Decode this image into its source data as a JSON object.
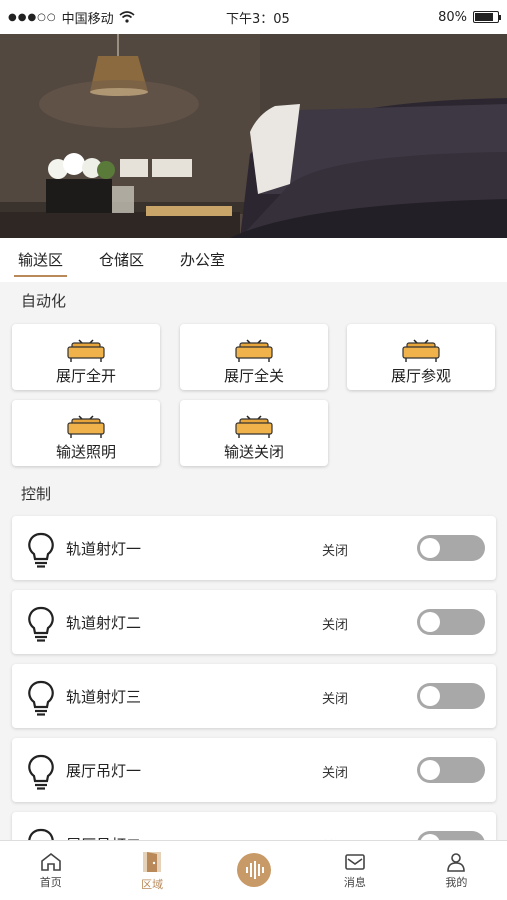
{
  "status_bar": {
    "carrier": "中国移动",
    "time": "下午3：05",
    "battery": "80%",
    "battery_level": 0.8
  },
  "tabs": [
    {
      "label": "输送区",
      "active": true
    },
    {
      "label": "仓储区"
    },
    {
      "label": "办公室"
    }
  ],
  "sections": {
    "automation": "自动化",
    "control": "控制"
  },
  "scenes": [
    {
      "label": "展厅全开"
    },
    {
      "label": "展厅全关"
    },
    {
      "label": "展厅参观"
    },
    {
      "label": "输送照明"
    },
    {
      "label": "输送关闭"
    }
  ],
  "controls": [
    {
      "name": "轨道射灯一",
      "status": "关闭",
      "on": false
    },
    {
      "name": "轨道射灯二",
      "status": "关闭",
      "on": false
    },
    {
      "name": "轨道射灯三",
      "status": "关闭",
      "on": false
    },
    {
      "name": "展厅吊灯一",
      "status": "关闭",
      "on": false
    },
    {
      "name": "展厅吊灯二",
      "status": "关闭",
      "on": false
    }
  ],
  "bottom_nav": [
    {
      "label": "首页",
      "icon": "home-icon"
    },
    {
      "label": "区域",
      "icon": "door-icon",
      "active": true
    },
    {
      "label": "",
      "icon": "voice-icon"
    },
    {
      "label": "消息",
      "icon": "mail-icon"
    },
    {
      "label": "我的",
      "icon": "user-icon"
    }
  ],
  "colors": {
    "accent": "#b9895a",
    "toggle_off": "#a8a8a8",
    "scene_icon": "#e7a53a"
  }
}
